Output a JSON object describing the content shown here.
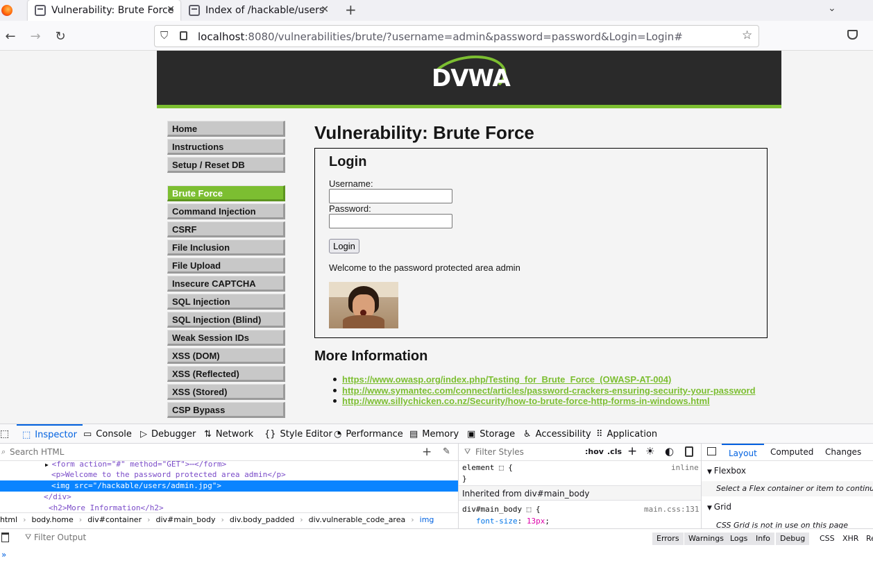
{
  "browser": {
    "tabs": [
      {
        "title": "Vulnerability: Brute Force",
        "active": true
      },
      {
        "title": "Index of /hackable/users",
        "active": false
      }
    ],
    "url_host": "localhost",
    "url_rest": ":8080/vulnerabilities/brute/?username=admin&password=password&Login=Login#"
  },
  "site": {
    "logo": "DVWA",
    "menu_top": [
      "Home",
      "Instructions",
      "Setup / Reset DB"
    ],
    "menu_vuln": [
      "Brute Force",
      "Command Injection",
      "CSRF",
      "File Inclusion",
      "File Upload",
      "Insecure CAPTCHA",
      "SQL Injection",
      "SQL Injection (Blind)",
      "Weak Session IDs",
      "XSS (DOM)",
      "XSS (Reflected)",
      "XSS (Stored)",
      "CSP Bypass"
    ],
    "selected": "Brute Force",
    "page_title": "Vulnerability: Brute Force",
    "login": {
      "heading": "Login",
      "username_label": "Username:",
      "password_label": "Password:",
      "button": "Login",
      "welcome": "Welcome to the password protected area admin"
    },
    "more_info": {
      "heading": "More Information",
      "links": [
        "https://www.owasp.org/index.php/Testing_for_Brute_Force_(OWASP-AT-004)",
        "http://www.symantec.com/connect/articles/password-crackers-ensuring-security-your-password",
        "http://www.sillychicken.co.nz/Security/how-to-brute-force-http-forms-in-windows.html"
      ]
    }
  },
  "devtools": {
    "tabs": [
      "Inspector",
      "Console",
      "Debugger",
      "Network",
      "Style Editor",
      "Performance",
      "Memory",
      "Storage",
      "Accessibility",
      "Application"
    ],
    "search_placeholder": "Search HTML",
    "code_lines": [
      "<form action=\"#\" method=\"GET\">⋯</form>",
      "<p>Welcome to the password protected area admin</p>",
      "<img src=\"/hackable/users/admin.jpg\">",
      "</div>",
      "<h2>More Information</h2>"
    ],
    "breadcrumb": [
      "html",
      "body.home",
      "div#container",
      "div#main_body",
      "div.body_padded",
      "div.vulnerable_code_area",
      "img"
    ],
    "filter_styles": "Filter Styles",
    "hov": ":hov",
    "cls": ".cls",
    "rule_element": "element",
    "rule_inline": "inline",
    "inherited": "Inherited from div#main_body",
    "rule_selector": "div#main_body",
    "rule_source": "main.css:131",
    "rule_prop": "font-size",
    "rule_value": "13px",
    "layout_tabs": [
      "Layout",
      "Computed",
      "Changes"
    ],
    "flexbox": "Flexbox",
    "flex_note": "Select a Flex container or item to continue.",
    "grid": "Grid",
    "grid_note": "CSS Grid is not in use on this page",
    "filter_output": "Filter Output",
    "console_buttons": [
      "Errors",
      "Warnings",
      "Logs",
      "Info",
      "Debug"
    ],
    "console_right": [
      "CSS",
      "XHR",
      "Re"
    ]
  }
}
